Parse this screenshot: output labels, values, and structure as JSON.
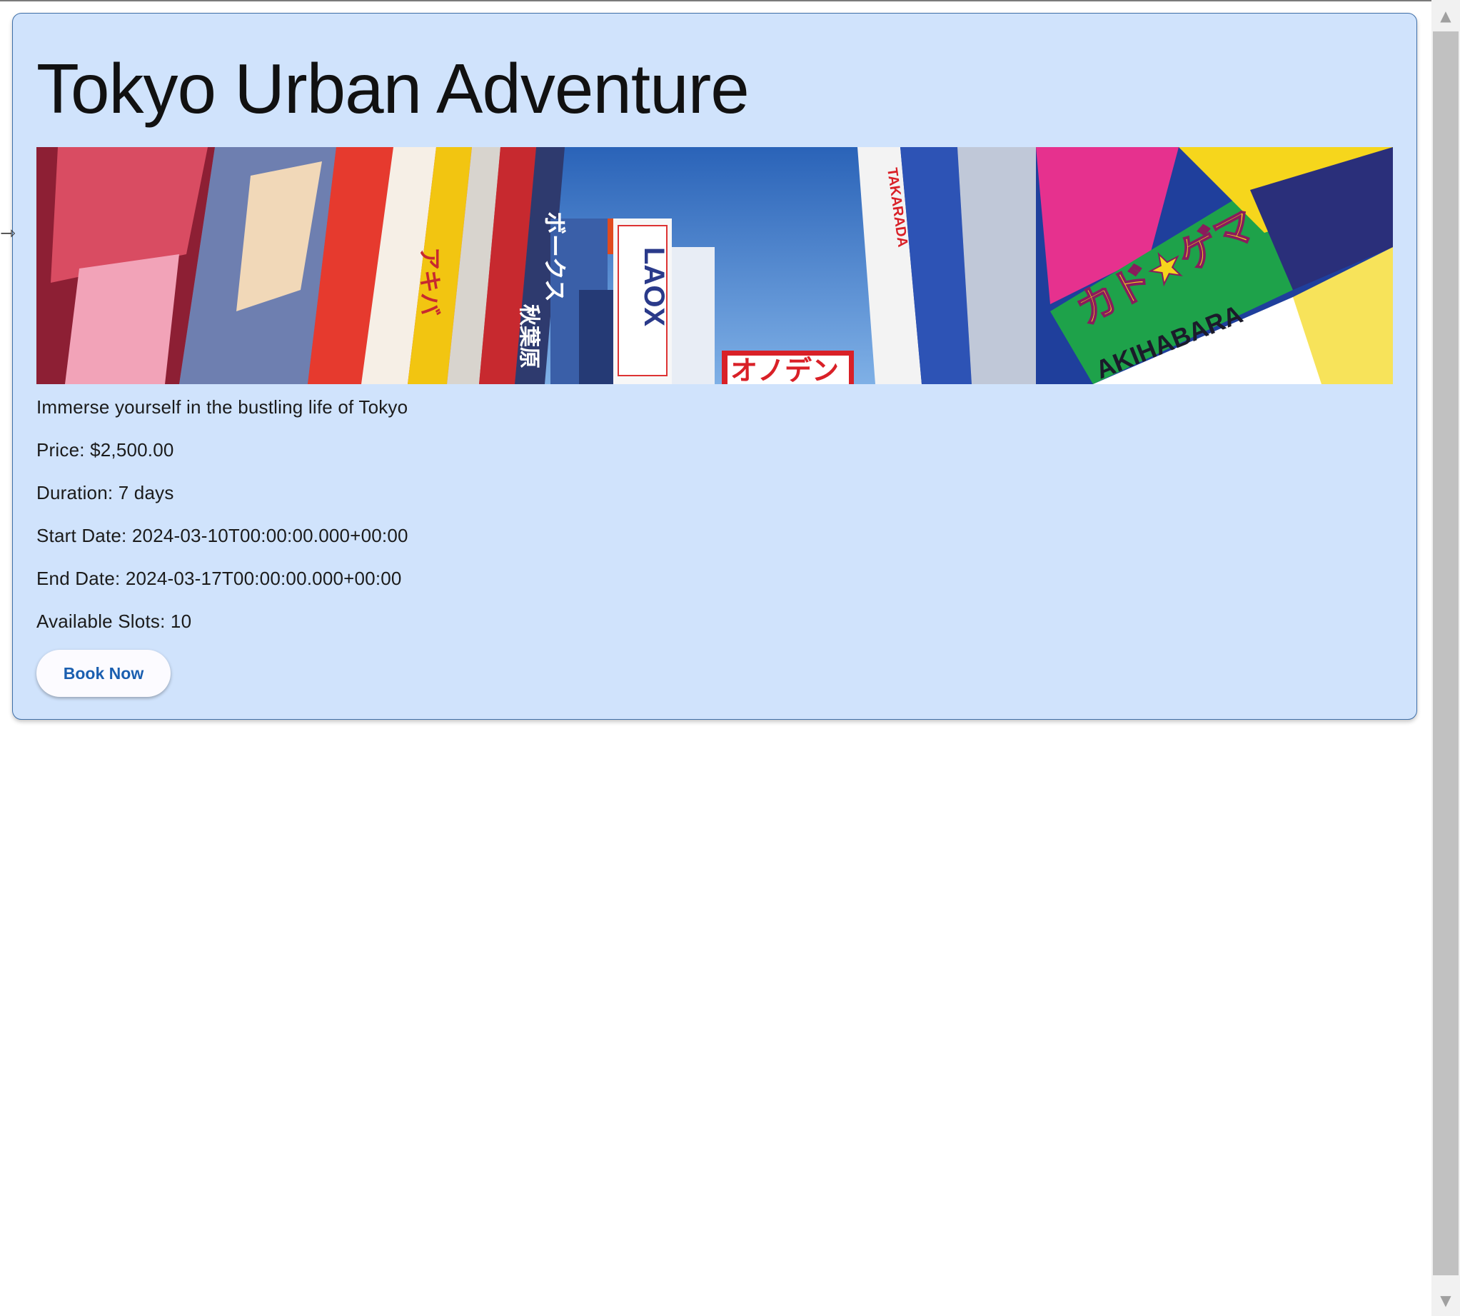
{
  "tour": {
    "title": "Tokyo Urban Adventure",
    "description": "Immerse yourself in the bustling life of Tokyo",
    "price": "Price: $2,500.00",
    "duration": "Duration: 7 days",
    "start_date": "Start Date: 2024-03-10T00:00:00.000+00:00",
    "end_date": "End Date: 2024-03-17T00:00:00.000+00:00",
    "available_slots": "Available Slots: 10",
    "book_label": "Book Now"
  },
  "banner_signs": {
    "laox": "LAOX",
    "onoden": "オノデン",
    "takarada": "TAKARADA",
    "akihabara": "AKIHABARA",
    "gamers": "カド★ゲマ",
    "borks": "ボークス",
    "akihabara_kanji": "秋葉原",
    "akiba": "アキバ"
  },
  "colors": {
    "card_background": "#d0e3fc",
    "card_border": "#3f6fa8",
    "button_text": "#1b5fb0"
  },
  "icons": {
    "scroll_up": "scroll-up-arrow-icon",
    "scroll_down": "scroll-down-arrow-icon",
    "cursor": "resize-cursor-icon"
  }
}
